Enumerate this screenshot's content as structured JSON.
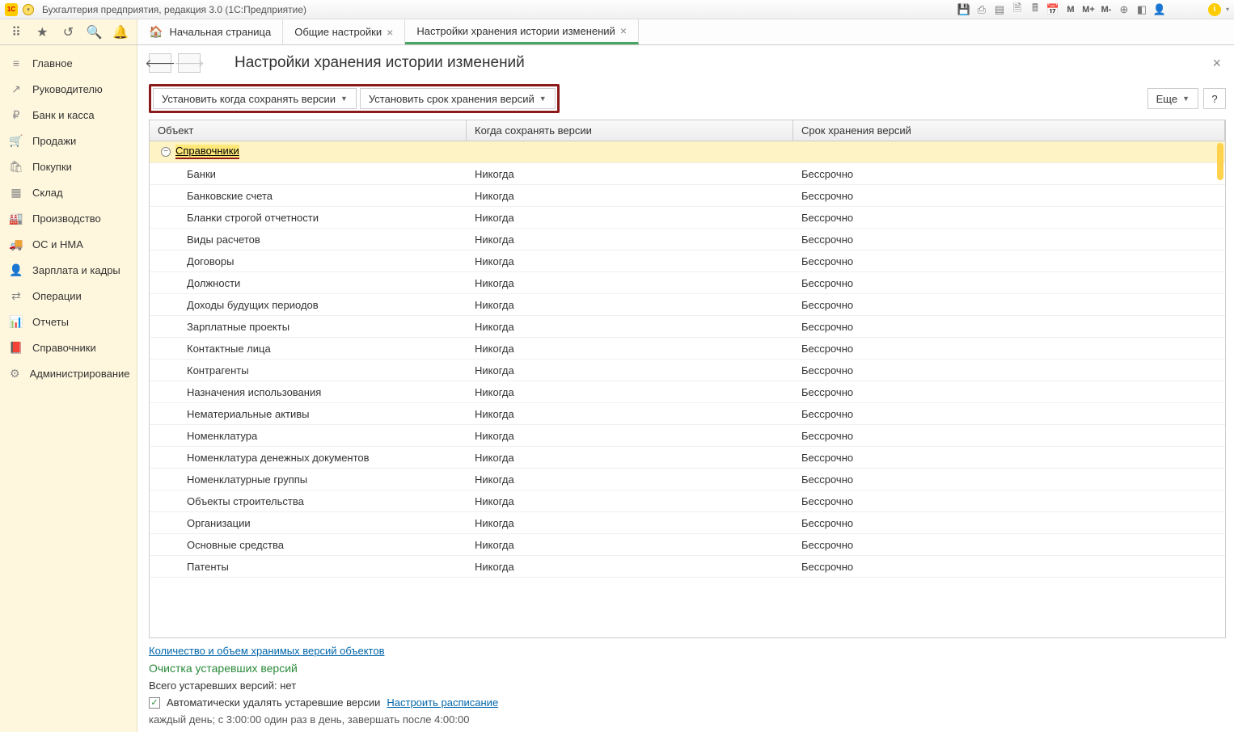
{
  "titlebar": {
    "logo": "1C",
    "title": "Бухгалтерия предприятия, редакция 3.0  (1С:Предприятие)",
    "right_icons": [
      "save-icon",
      "print-icon",
      "table-icon",
      "doc-icon",
      "calc-icon",
      "calendar-icon"
    ],
    "m_buttons": [
      "M",
      "M+",
      "M-"
    ],
    "more_icons": [
      "zoom-icon",
      "window-icon",
      "user-icon"
    ],
    "info": "i"
  },
  "toolbar": {
    "icons": [
      "apps-icon",
      "star-icon",
      "history-icon",
      "search-icon",
      "bell-icon"
    ]
  },
  "tabs": {
    "home": "Начальная страница",
    "items": [
      {
        "label": "Общие настройки",
        "closable": true,
        "active": false
      },
      {
        "label": "Настройки хранения истории изменений",
        "closable": true,
        "active": true
      }
    ]
  },
  "sidebar": {
    "items": [
      {
        "icon": "≡",
        "label": "Главное"
      },
      {
        "icon": "↗",
        "label": "Руководителю"
      },
      {
        "icon": "₽",
        "label": "Банк и касса"
      },
      {
        "icon": "🛒",
        "label": "Продажи"
      },
      {
        "icon": "🛍",
        "label": "Покупки"
      },
      {
        "icon": "▦",
        "label": "Склад"
      },
      {
        "icon": "🏭",
        "label": "Производство"
      },
      {
        "icon": "🚚",
        "label": "ОС и НМА"
      },
      {
        "icon": "👤",
        "label": "Зарплата и кадры"
      },
      {
        "icon": "⇄",
        "label": "Операции"
      },
      {
        "icon": "📊",
        "label": "Отчеты"
      },
      {
        "icon": "📕",
        "label": "Справочники"
      },
      {
        "icon": "⚙",
        "label": "Администрирование"
      }
    ]
  },
  "page": {
    "title": "Настройки хранения истории изменений",
    "cmd1": "Установить когда сохранять версии",
    "cmd2": "Установить срок хранения версий",
    "more": "Еще",
    "help": "?"
  },
  "table": {
    "headers": [
      "Объект",
      "Когда сохранять версии",
      "Срок хранения версий"
    ],
    "group": "Справочники",
    "rows": [
      {
        "obj": "Банки",
        "when": "Никогда",
        "term": "Бессрочно"
      },
      {
        "obj": "Банковские счета",
        "when": "Никогда",
        "term": "Бессрочно"
      },
      {
        "obj": "Бланки строгой отчетности",
        "when": "Никогда",
        "term": "Бессрочно"
      },
      {
        "obj": "Виды расчетов",
        "when": "Никогда",
        "term": "Бессрочно"
      },
      {
        "obj": "Договоры",
        "when": "Никогда",
        "term": "Бессрочно"
      },
      {
        "obj": "Должности",
        "when": "Никогда",
        "term": "Бессрочно"
      },
      {
        "obj": "Доходы будущих периодов",
        "when": "Никогда",
        "term": "Бессрочно"
      },
      {
        "obj": "Зарплатные проекты",
        "when": "Никогда",
        "term": "Бессрочно"
      },
      {
        "obj": "Контактные лица",
        "when": "Никогда",
        "term": "Бессрочно"
      },
      {
        "obj": "Контрагенты",
        "when": "Никогда",
        "term": "Бессрочно"
      },
      {
        "obj": "Назначения использования",
        "when": "Никогда",
        "term": "Бессрочно"
      },
      {
        "obj": "Нематериальные активы",
        "when": "Никогда",
        "term": "Бессрочно"
      },
      {
        "obj": "Номенклатура",
        "when": "Никогда",
        "term": "Бессрочно"
      },
      {
        "obj": "Номенклатура денежных документов",
        "when": "Никогда",
        "term": "Бессрочно"
      },
      {
        "obj": "Номенклатурные группы",
        "when": "Никогда",
        "term": "Бессрочно"
      },
      {
        "obj": "Объекты строительства",
        "when": "Никогда",
        "term": "Бессрочно"
      },
      {
        "obj": "Организации",
        "when": "Никогда",
        "term": "Бессрочно"
      },
      {
        "obj": "Основные средства",
        "when": "Никогда",
        "term": "Бессрочно"
      },
      {
        "obj": "Патенты",
        "when": "Никогда",
        "term": "Бессрочно"
      }
    ]
  },
  "footer": {
    "link1": "Количество и объем хранимых версий объектов",
    "section": "Очистка устаревших версий",
    "total": "Всего устаревших версий: нет",
    "chk_label": "Автоматически удалять устаревшие версии",
    "schedule_link": "Настроить расписание",
    "schedule": "каждый день; с 3:00:00 один раз в день, завершать после 4:00:00"
  }
}
